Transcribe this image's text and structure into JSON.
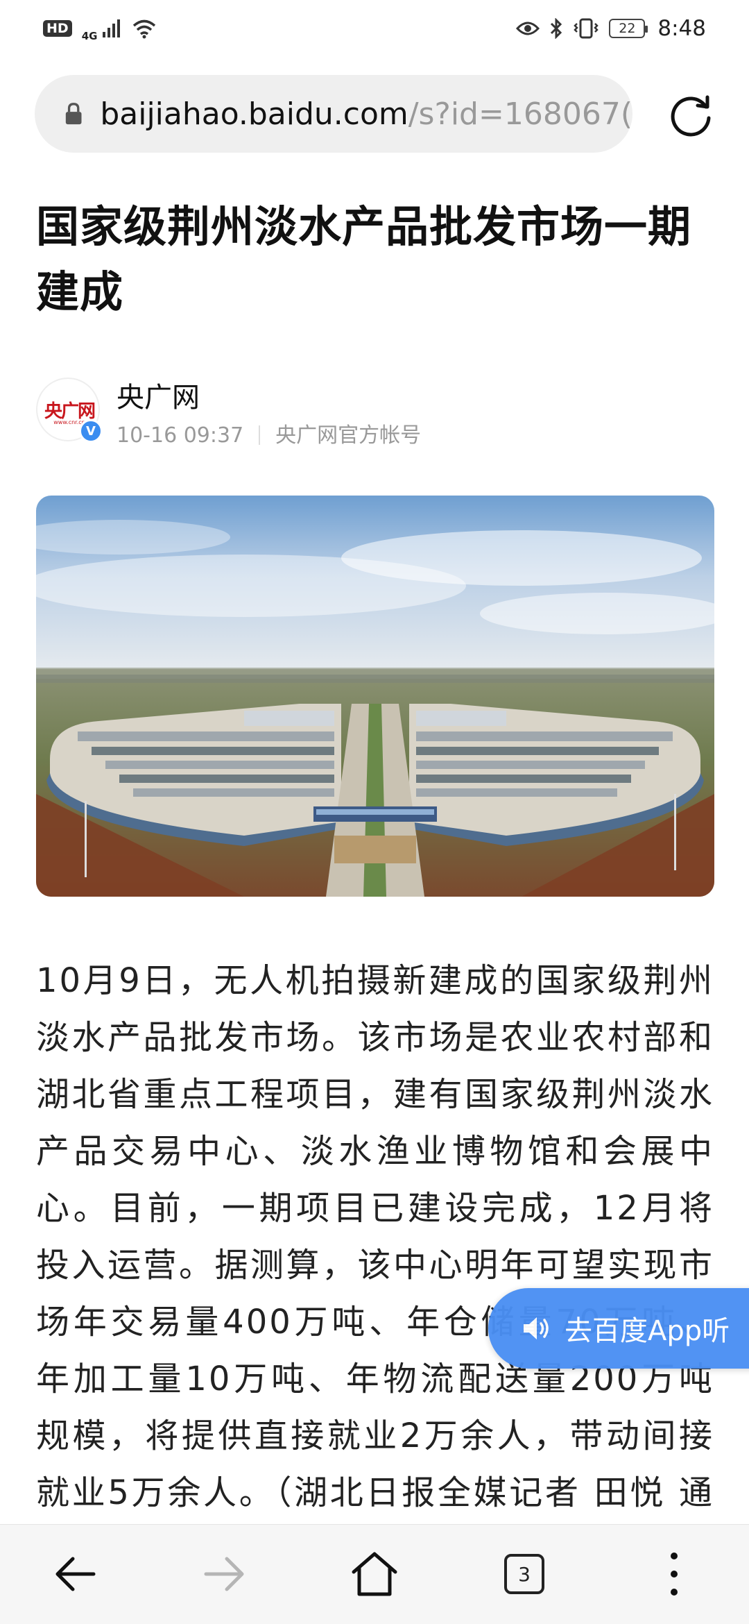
{
  "status_bar": {
    "hd_badge": "HD",
    "network": "4G",
    "battery_level": "22",
    "time": "8:48"
  },
  "browser": {
    "url_host": "baijiahao.baidu.com",
    "url_path": "/s?id=168067(",
    "tabs_count": "3"
  },
  "article": {
    "title": "国家级荆州淡水产品批发市场一期建成",
    "author": {
      "name": "央广网",
      "avatar_logo": "央广网",
      "avatar_sub": "www.cnr.cn",
      "datetime": "10-16 09:37",
      "account_type": "央广网官方帐号"
    },
    "body": "10月9日，无人机拍摄新建成的国家级荆州淡水产品批发市场。该市场是农业农村部和湖北省重点工程项目，建有国家级荆州淡水产品交易中心、淡水渔业博物馆和会展中心。目前，一期项目已建设完成，12月将投入运营。据测算，该中心明年可望实现市场年交易量400万吨、年仓储量70万吨、年加工量10万吨、年物流配送量200万吨规模，将提供直接就业2万余人，带动间接就业5万余人。（湖北日报全媒记者 田悦 通讯员 黄才刚 摄）"
  },
  "listen_button": {
    "label": "去百度App听"
  },
  "colors": {
    "accent": "#4a8ff3",
    "verified": "#3b8df0",
    "brand_red": "#c8161d"
  }
}
